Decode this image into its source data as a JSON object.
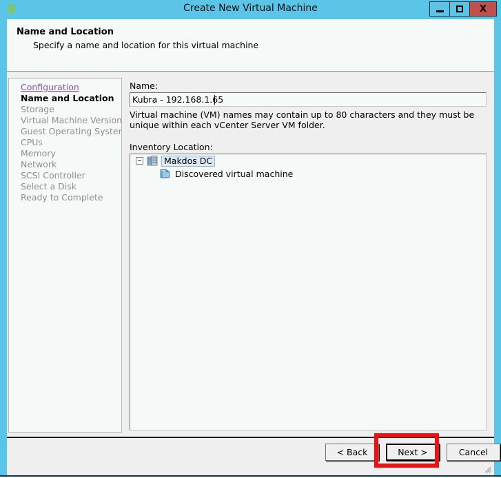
{
  "window": {
    "title": "Create New Virtual Machine",
    "icon": "vm-app-icon",
    "controls": {
      "minimize": "minimize-icon",
      "maximize": "maximize-icon",
      "close": "X"
    },
    "accent_color": "#5bc5e8",
    "close_color": "#c0504d"
  },
  "header": {
    "title": "Name and Location",
    "subtitle": "Specify a name and location for this virtual machine"
  },
  "sidebar": {
    "items": [
      {
        "label": "Configuration",
        "state": "link"
      },
      {
        "label": "Name and Location",
        "state": "current"
      },
      {
        "label": "Storage",
        "state": "pending"
      },
      {
        "label": "Virtual Machine Version",
        "state": "pending"
      },
      {
        "label": "Guest Operating System",
        "state": "pending"
      },
      {
        "label": "CPUs",
        "state": "pending"
      },
      {
        "label": "Memory",
        "state": "pending"
      },
      {
        "label": "Network",
        "state": "pending"
      },
      {
        "label": "SCSI Controller",
        "state": "pending"
      },
      {
        "label": "Select a Disk",
        "state": "pending"
      },
      {
        "label": "Ready to Complete",
        "state": "pending"
      }
    ]
  },
  "main": {
    "name_label": "Name:",
    "name_value": "Kubra - 192.168.1.65",
    "name_placeholder": "",
    "help_text": "Virtual machine (VM) names may contain up to 80 characters and they must be unique within each vCenter Server VM folder.",
    "inventory_label": "Inventory Location:",
    "tree": {
      "root": {
        "label": "Makdos DC",
        "icon": "datacenter-icon",
        "expanded": true,
        "selected": true
      },
      "children": [
        {
          "label": "Discovered virtual machine",
          "icon": "folder-icon"
        }
      ]
    }
  },
  "footer": {
    "back_label": "< Back",
    "next_label": "Next >",
    "cancel_label": "Cancel"
  },
  "annotation": {
    "target": "next-button",
    "color": "#ee1111"
  }
}
